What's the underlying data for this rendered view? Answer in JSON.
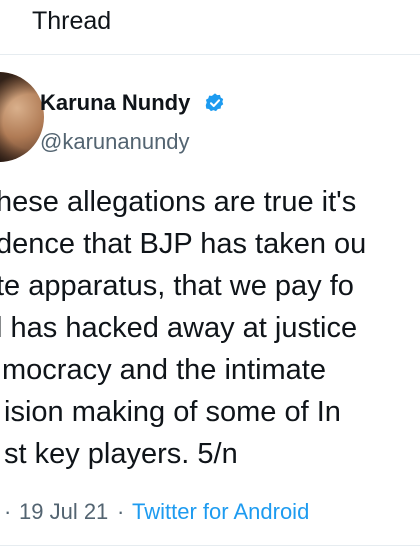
{
  "header": {
    "title": "Thread"
  },
  "tweet": {
    "author": {
      "display_name": "Karuna Nundy",
      "handle": "@karunanundy",
      "verified": true
    },
    "text_lines": [
      "hese allegations are true it's",
      "dence that BJP has taken ou",
      "te apparatus, that we pay fo",
      "l has hacked away at justice",
      "mocracy and the intimate",
      "ision making of some of In",
      "st key players. 5/n"
    ],
    "meta": {
      "time": "",
      "separator": "·",
      "date": "19 Jul 21",
      "source": "Twitter for Android"
    }
  },
  "colors": {
    "text": "#0f1419",
    "secondary": "#536471",
    "accent": "#1d9bf0",
    "divider": "#e6ecf0"
  }
}
